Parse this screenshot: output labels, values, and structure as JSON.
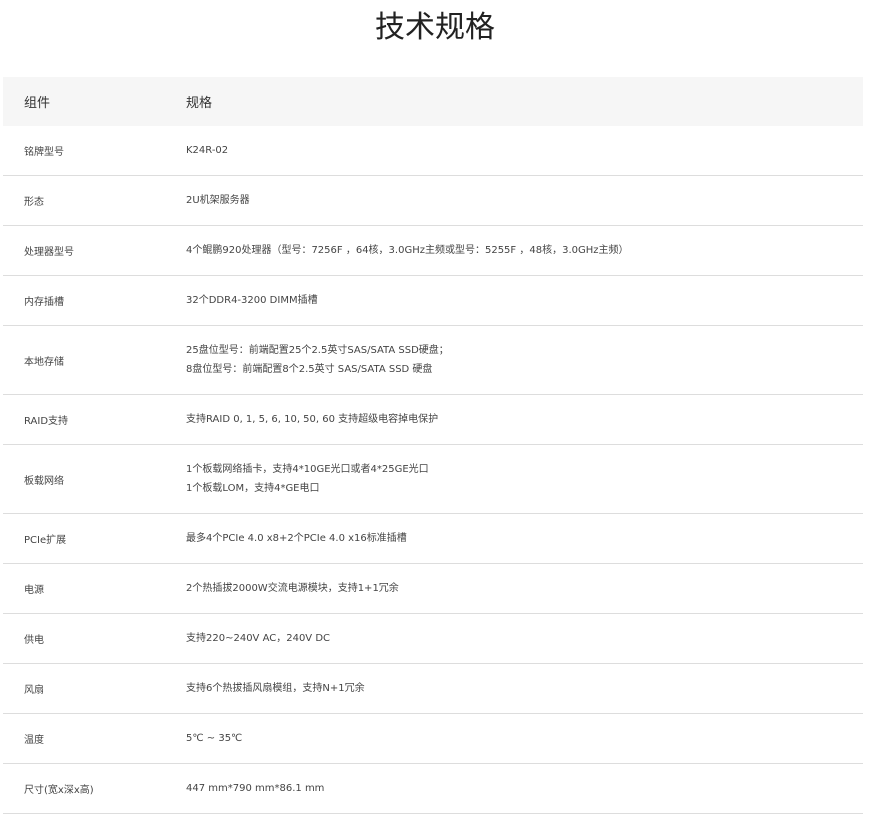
{
  "page": {
    "title": "技术规格"
  },
  "table": {
    "headers": [
      "组件",
      "规格"
    ],
    "rows": [
      {
        "component": "铭牌型号",
        "spec": [
          "K24R-02"
        ]
      },
      {
        "component": "形态",
        "spec": [
          "2U机架服务器"
        ]
      },
      {
        "component": "处理器型号",
        "spec": [
          "4个鲲鹏920处理器（型号：7256F ，64核，3.0GHz主频或型号：5255F ，48核，3.0GHz主频）"
        ]
      },
      {
        "component": "内存插槽",
        "spec": [
          "32个DDR4-3200 DIMM插槽"
        ]
      },
      {
        "component": "本地存储",
        "spec": [
          "25盘位型号：前端配置25个2.5英寸SAS/SATA SSD硬盘；",
          "8盘位型号：前端配置8个2.5英寸 SAS/SATA SSD 硬盘"
        ]
      },
      {
        "component": "RAID支持",
        "spec": [
          "支持RAID 0, 1, 5, 6, 10, 50, 60 支持超级电容掉电保护"
        ]
      },
      {
        "component": "板载网络",
        "spec": [
          "1个板载网络插卡，支持4*10GE光口或者4*25GE光口",
          "1个板载LOM，支持4*GE电口"
        ]
      },
      {
        "component": "PCIe扩展",
        "spec": [
          "最多4个PCIe 4.0 x8+2个PCIe 4.0 x16标准插槽"
        ]
      },
      {
        "component": "电源",
        "spec": [
          "2个热插拔2000W交流电源模块，支持1+1冗余"
        ]
      },
      {
        "component": "供电",
        "spec": [
          "支持220~240V AC，240V DC"
        ]
      },
      {
        "component": "风扇",
        "spec": [
          "支持6个热拔插风扇模组，支持N+1冗余"
        ]
      },
      {
        "component": "温度",
        "spec": [
          "5℃ ~ 35℃"
        ]
      },
      {
        "component": "尺寸(宽x深x高)",
        "spec": [
          "447 mm*790 mm*86.1 mm"
        ]
      }
    ]
  }
}
